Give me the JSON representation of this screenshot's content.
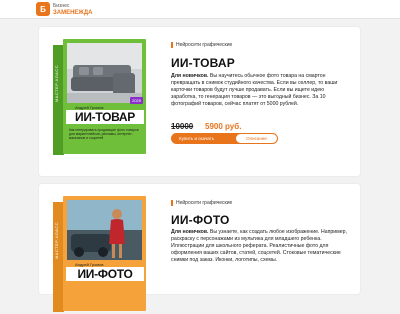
{
  "header": {
    "logo_mark": "Б",
    "logo_top": "Бизнес",
    "logo_bottom": "ЗАМЕНЕЖДА"
  },
  "products": [
    {
      "tag": "Нейросети графические",
      "title": "ИИ-ТОВАР",
      "desc_lead": "Для новичков.",
      "desc_body": " Вы научитесь обычное фото товара на смартон превращать в снимок студийного качества. Если вы селлер, то ваши карточки товаров будут лучше продавать. Если вы ищете идею заработка, то генерация товаров — это выгодный бизнес. За 10 фотографий товаров, сейчас платят от 5000 рублей.",
      "price_old": "10000",
      "price_new": "5900 руб.",
      "buy_label": "Купить и скачать",
      "more_label": "Описание",
      "box": {
        "author": "Андрей Громов",
        "title": "ИИ-ТОВАР",
        "year": "2025",
        "spine": "МАСТЕР-КЛАСС",
        "desc": "Как генерировать продающие фото товаров для маркетплейсов, рекламы, интернет-магазинов и соцсетей",
        "color": "#6fbf3a"
      }
    },
    {
      "tag": "Нейросети графические",
      "title": "ИИ-ФОТО",
      "desc_lead": "Для новичков.",
      "desc_body": " Вы узнаете, как создать любое изображение. Например, раскраску с персонажами из мультика для младшего ребенка. Иллюстрации для школьного реферата. Реалистичные фото для оформления ваших сайтов, статей, соцсетей. Стоковые тематические снимки под заказ. Иконки, логотипы, схемы.",
      "box": {
        "author": "Андрей Громов",
        "title": "ИИ-ФОТО",
        "spine": "МАСТЕР-КЛАСС",
        "color": "#f5a23a"
      }
    }
  ]
}
